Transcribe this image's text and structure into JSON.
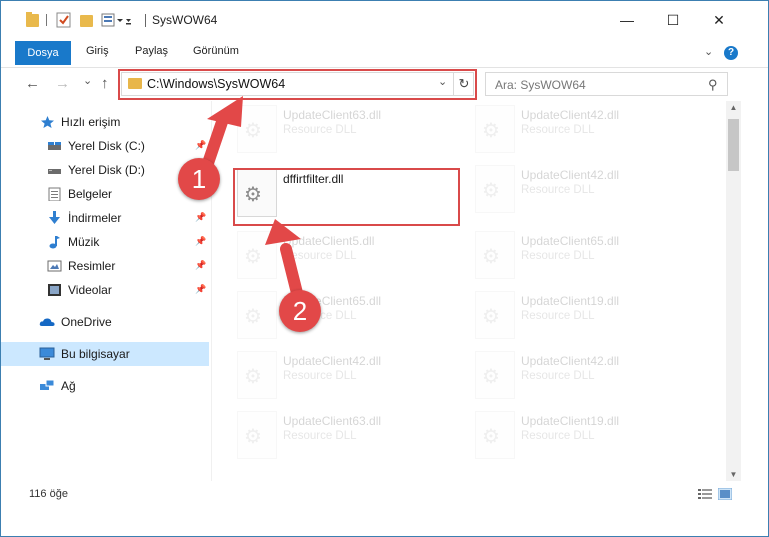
{
  "window": {
    "title": "SysWOW64",
    "minimize": "—",
    "maximize": "☐",
    "close": "✕"
  },
  "ribbon": {
    "tabs": [
      "Dosya",
      "Giriş",
      "Paylaş",
      "Görünüm"
    ],
    "help": "?"
  },
  "nav": {
    "back": "←",
    "forward": "→",
    "recent": "⌄",
    "up": "↑",
    "address": "C:\\Windows\\SysWOW64",
    "search_placeholder": "Ara: SysWOW64"
  },
  "sidebar": {
    "items": [
      {
        "label": "Hızlı erişim",
        "icon": "star-icon"
      },
      {
        "label": "Yerel Disk (C:)",
        "icon": "drive-icon",
        "pinned": true
      },
      {
        "label": "Yerel Disk (D:)",
        "icon": "drive-icon"
      },
      {
        "label": "Belgeler",
        "icon": "documents-icon"
      },
      {
        "label": "İndirmeler",
        "icon": "downloads-icon",
        "pinned": true
      },
      {
        "label": "Müzik",
        "icon": "music-icon",
        "pinned": true
      },
      {
        "label": "Resimler",
        "icon": "pictures-icon",
        "pinned": true
      },
      {
        "label": "Videolar",
        "icon": "videos-icon",
        "pinned": true
      },
      {
        "label": "OneDrive",
        "icon": "onedrive-icon"
      },
      {
        "label": "Bu bilgisayar",
        "icon": "computer-icon",
        "selected": true
      },
      {
        "label": "Ağ",
        "icon": "network-icon"
      }
    ]
  },
  "files": {
    "highlighted": {
      "name": "dffirtfilter.dll"
    },
    "left": [
      {
        "name": "UpdateClient63.dll",
        "type": "Resource DLL"
      },
      {
        "name": "",
        "type": ""
      },
      {
        "name": "UpdateClient5.dll",
        "type": "Resource DLL"
      },
      {
        "name": "UpdateClient65.dll",
        "type": "Resource DLL"
      },
      {
        "name": "UpdateClient42.dll",
        "type": "Resource DLL"
      },
      {
        "name": "UpdateClient63.dll",
        "type": "Resource DLL"
      }
    ],
    "right": [
      {
        "name": "UpdateClient42.dll",
        "type": "Resource DLL"
      },
      {
        "name": "UpdateClient42.dll",
        "type": "Resource DLL"
      },
      {
        "name": "UpdateClient65.dll",
        "type": "Resource DLL"
      },
      {
        "name": "UpdateClient19.dll",
        "type": "Resource DLL"
      },
      {
        "name": "UpdateClient42.dll",
        "type": "Resource DLL"
      },
      {
        "name": "UpdateClient19.dll",
        "type": "Resource DLL"
      }
    ]
  },
  "status": {
    "item_count": "116 öğe"
  },
  "annotations": {
    "badge1": "1",
    "badge2": "2",
    "color": "#e24848"
  }
}
